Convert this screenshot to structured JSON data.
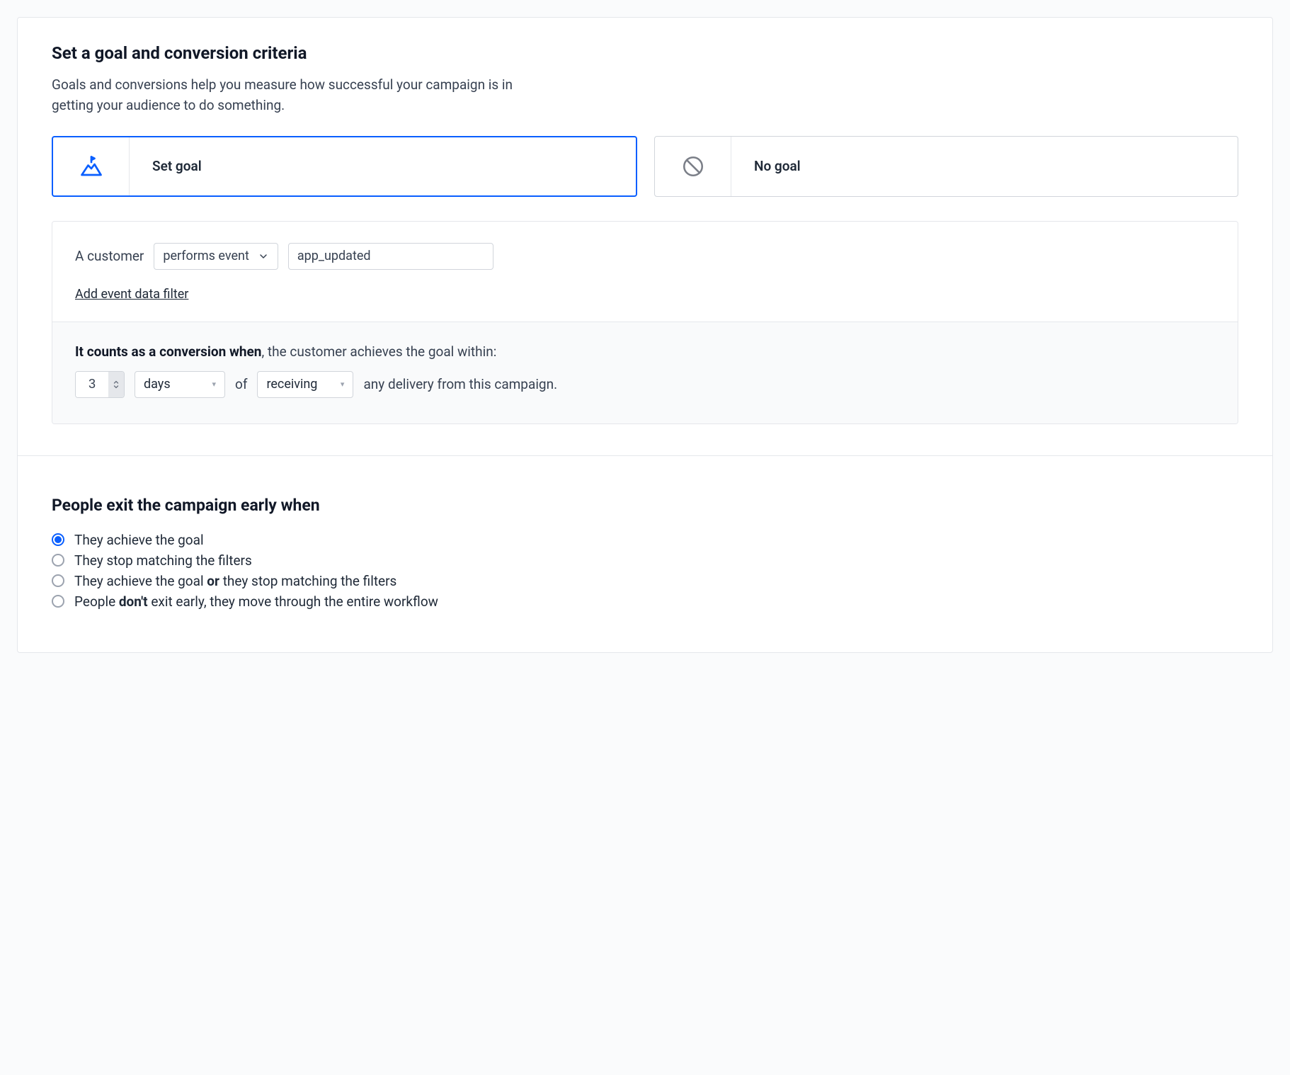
{
  "goal": {
    "heading": "Set a goal and conversion criteria",
    "subtitle": "Goals and conversions help you measure how successful your campaign is in getting your audience to do something.",
    "options": {
      "setGoal": "Set goal",
      "noGoal": "No goal"
    },
    "criteria": {
      "prefix": "A customer",
      "conditionSelect": "performs event",
      "eventValue": "app_updated",
      "addFilterLink": "Add event data filter"
    },
    "conversion": {
      "labelStrong": "It counts as a conversion when",
      "labelRest": ", the customer achieves the goal within:",
      "numberValue": "3",
      "unit": "days",
      "ofText": "of",
      "relative": "receiving",
      "tailText": "any delivery from this campaign."
    }
  },
  "exit": {
    "heading": "People exit the campaign early when",
    "options": [
      {
        "text": "They achieve the goal",
        "checked": true,
        "hasBoldOr": false,
        "hasBoldDont": false
      },
      {
        "text": "They stop matching the filters",
        "checked": false,
        "hasBoldOr": false,
        "hasBoldDont": false
      },
      {
        "textBefore": "They achieve the goal ",
        "bold": "or",
        "textAfter": " they stop matching the filters",
        "checked": false,
        "hasBoldOr": true,
        "hasBoldDont": false
      },
      {
        "textBefore": "People ",
        "bold": "don't",
        "textAfter": " exit early, they move through the entire workflow",
        "checked": false,
        "hasBoldOr": false,
        "hasBoldDont": true
      }
    ]
  }
}
